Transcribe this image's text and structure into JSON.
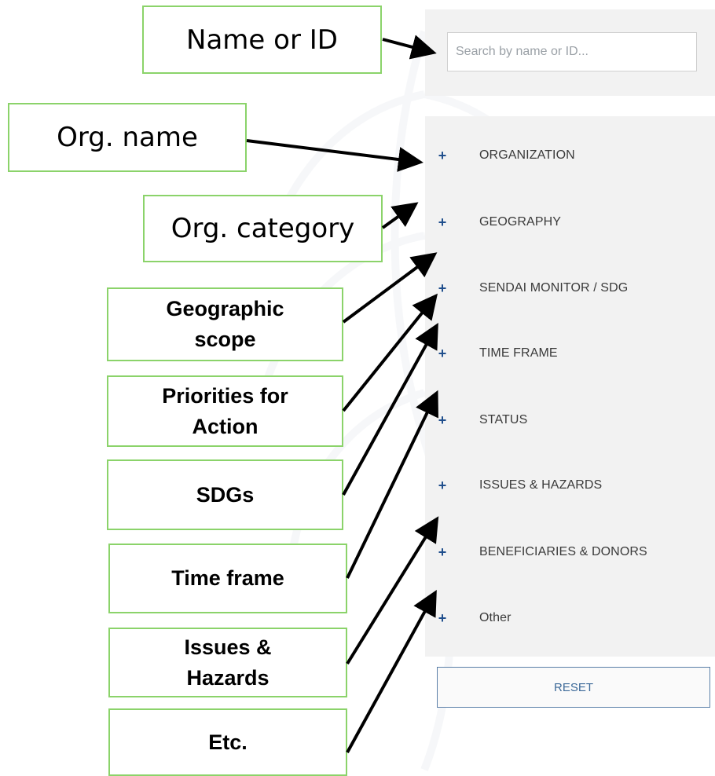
{
  "search": {
    "placeholder": "Search by name or ID..."
  },
  "filters": [
    {
      "label": "ORGANIZATION"
    },
    {
      "label": "GEOGRAPHY"
    },
    {
      "label": "SENDAI MONITOR / SDG"
    },
    {
      "label": "TIME FRAME"
    },
    {
      "label": "STATUS"
    },
    {
      "label": "ISSUES & HAZARDS"
    },
    {
      "label": "BENEFICIARIES & DONORS"
    },
    {
      "label": "Other"
    }
  ],
  "filter_icon": "plus-icon",
  "reset_label": "RESET",
  "callouts": {
    "name_or_id": "Name or ID",
    "org_name": "Org. name",
    "org_category": "Org. category",
    "geographic_scope": [
      "Geographic",
      "scope"
    ],
    "priorities_for_action": [
      "Priorities for",
      "Action"
    ],
    "sdgs": "SDGs",
    "time_frame": "Time frame",
    "issues_hazards": [
      "Issues &",
      "Hazards"
    ],
    "etc": "Etc."
  },
  "colors": {
    "accent": "#1f4e8c",
    "callout_border": "#8bd36a",
    "panel_bg": "#f2f2f2"
  }
}
